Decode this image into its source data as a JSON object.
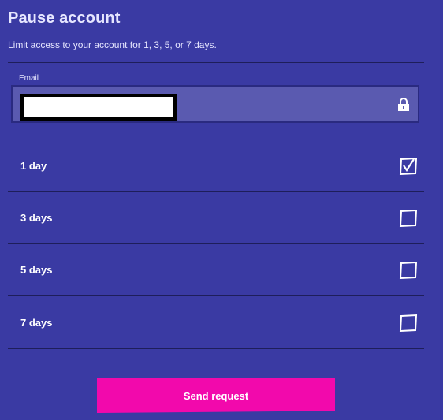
{
  "header": {
    "title": "Pause account",
    "subtitle": "Limit access to your account for 1, 3, 5, or 7 days."
  },
  "email": {
    "label": "Email",
    "value": "",
    "icon": "lock-icon"
  },
  "options": [
    {
      "label": "1 day",
      "checked": true
    },
    {
      "label": "3 days",
      "checked": false
    },
    {
      "label": "5 days",
      "checked": false
    },
    {
      "label": "7 days",
      "checked": false
    }
  ],
  "actions": {
    "send_label": "Send request"
  },
  "colors": {
    "background": "#3a3aa3",
    "field": "#5a5ab0",
    "accent": "#f209ac",
    "divider": "#1e1e5a"
  }
}
